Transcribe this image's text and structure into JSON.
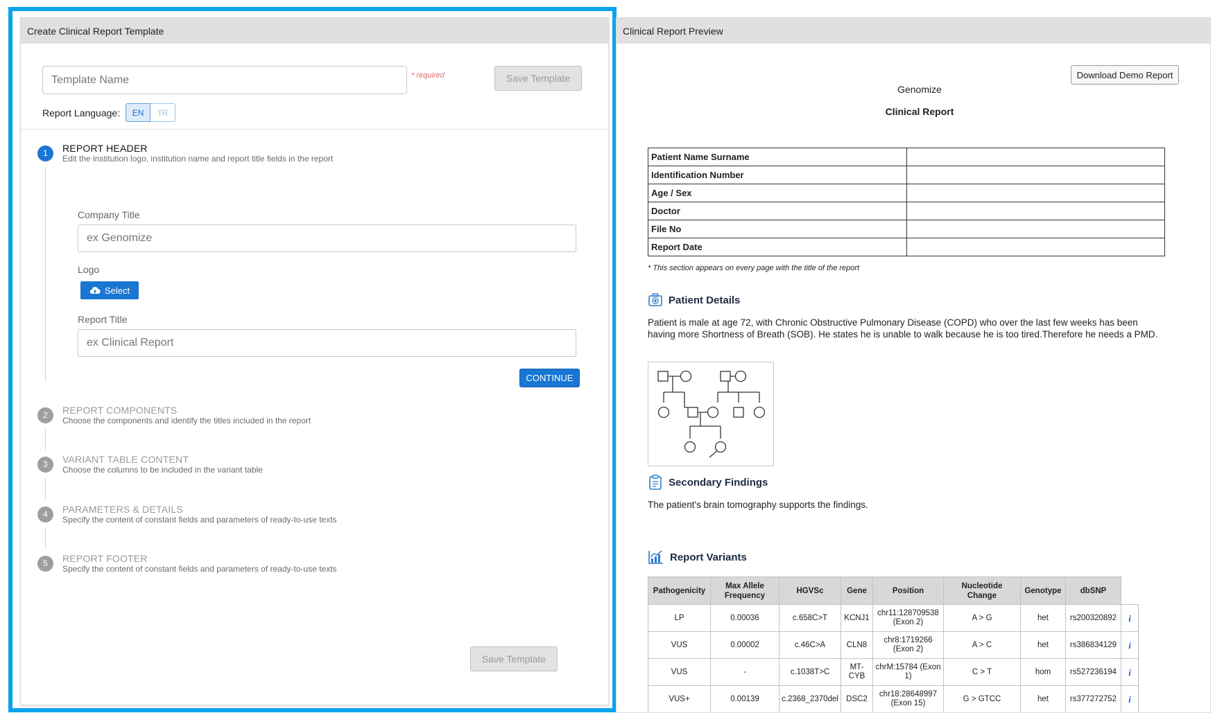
{
  "left": {
    "header_title": "Create Clinical Report Template",
    "template_name_placeholder": "Template Name",
    "required_note": "* required",
    "save_label": "Save Template",
    "language_label": "Report Language:",
    "languages": [
      "EN",
      "TR"
    ],
    "selected_language": "EN",
    "steps": [
      {
        "num": "1",
        "title": "REPORT HEADER",
        "desc": "Edit the institution logo, institution name and report title fields in the report"
      },
      {
        "num": "2",
        "title": "REPORT COMPONENTS",
        "desc": "Choose the components and identify the titles included in the report"
      },
      {
        "num": "3",
        "title": "VARIANT TABLE CONTENT",
        "desc": "Choose the columns to be included in the variant table"
      },
      {
        "num": "4",
        "title": "PARAMETERS & DETAILS",
        "desc": "Specify the content of constant fields and parameters of ready-to-use texts"
      },
      {
        "num": "5",
        "title": "REPORT FOOTER",
        "desc": "Specify the content of constant fields and parameters of ready-to-use texts"
      }
    ],
    "form": {
      "company_label": "Company Title",
      "company_placeholder": "ex Genomize",
      "logo_label": "Logo",
      "select_label": "Select",
      "report_title_label": "Report Title",
      "report_title_placeholder": "ex Clinical Report",
      "continue_label": "CONTINUE"
    }
  },
  "right": {
    "header_title": "Clinical Report Preview",
    "download_label": "Download Demo Report",
    "company": "Genomize",
    "report_title": "Clinical Report",
    "patient_fields": [
      "Patient Name Surname",
      "Identification Number",
      "Age / Sex",
      "Doctor",
      "File No",
      "Report Date"
    ],
    "header_note": "* This section appears on every page with the title of the report",
    "patient_details_title": "Patient Details",
    "patient_details_text": "Patient is male at age 72, with Chronic Obstructive Pulmonary Disease (COPD) who over the last few weeks has been having more Shortness of Breath (SOB). He states he is unable to walk because he is too tired.Therefore he needs a PMD.",
    "secondary_title": "Secondary Findings",
    "secondary_text": "The patient's brain tomography supports the findings.",
    "variants_title": "Report Variants",
    "variant_columns": [
      "Pathogenicity",
      "Max Allele Frequency",
      "HGVSc",
      "Gene",
      "Position",
      "Nucleotide Change",
      "Genotype",
      "dbSNP"
    ],
    "variant_rows": [
      [
        "LP",
        "0.00036",
        "c.658C>T",
        "KCNJ1",
        "chr11:128709538 (Exon 2)",
        "A > G",
        "het",
        "rs200320892"
      ],
      [
        "VUS",
        "0.00002",
        "c.46C>A",
        "CLN8",
        "chr8:1719266 (Exon 2)",
        "A > C",
        "het",
        "rs386834129"
      ],
      [
        "VUS",
        "-",
        "c.1038T>C",
        "MT-CYB",
        "chrM:15784 (Exon 1)",
        "C > T",
        "hom",
        "rs527236194"
      ],
      [
        "VUS+",
        "0.00139",
        "c.2368_2370del",
        "DSC2",
        "chr18:28648997 (Exon 15)",
        "G > GTCC",
        "het",
        "rs377272752"
      ]
    ],
    "info_symbol": "i"
  },
  "colors": {
    "accent": "#1976d2",
    "frame": "#0aa3ee",
    "header_bg": "#e0e0e0"
  },
  "icons": [
    "cloud-upload-icon",
    "medical-kit-icon",
    "clipboard-icon",
    "chart-icon",
    "pedigree-chart"
  ]
}
